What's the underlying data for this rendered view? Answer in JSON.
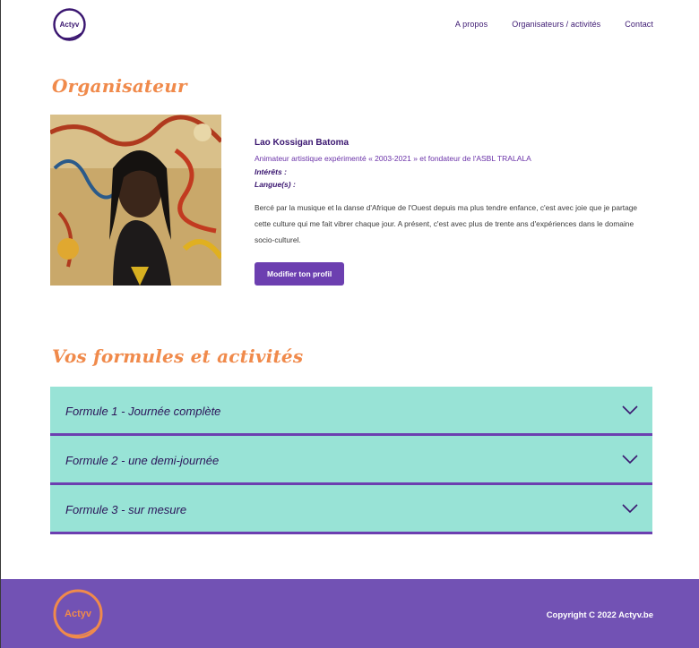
{
  "brand": {
    "logo_text": "Actyv"
  },
  "nav": {
    "items": [
      {
        "label": "A propos"
      },
      {
        "label": "Organisateurs / activités"
      },
      {
        "label": "Contact"
      }
    ]
  },
  "organizer": {
    "section_title": "Organisateur",
    "name": "Lao Kossigan Batoma",
    "role": "Animateur artistique expérimenté « 2003-2021 » et fondateur de l'ASBL TRALALA",
    "interests_label": "Intérêts :",
    "languages_label": "Langue(s) :",
    "bio": "Bercé par la musique et la danse d'Afrique de l'Ouest depuis ma plus tendre enfance, c'est avec joie que je partage cette culture qui me fait vibrer chaque jour. A présent, c'est avec plus de trente ans d'expériences dans le domaine socio-culturel.",
    "edit_button": "Modifier ton profil"
  },
  "formulas": {
    "section_title": "Vos formules et activités",
    "items": [
      {
        "label": "Formule 1 - Journée complète"
      },
      {
        "label": "Formule 2 - une demi-journée"
      },
      {
        "label": "Formule 3 - sur mesure"
      }
    ]
  },
  "footer": {
    "logo_text": "Actyv",
    "copyright": "Copyright C 2022 Actyv.be"
  },
  "colors": {
    "accent_orange": "#f08a4b",
    "purple": "#6c3fb0",
    "footer_purple": "#7252b4",
    "accordion_teal": "#98e3d6",
    "text_dark": "#3a1670"
  }
}
